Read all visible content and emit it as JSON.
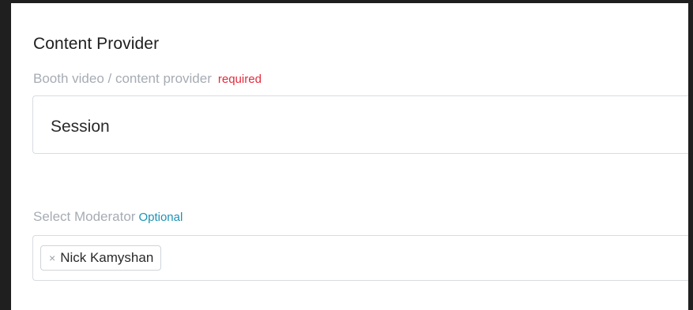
{
  "section": {
    "title": "Content Provider"
  },
  "content_provider": {
    "label": "Booth video / content provider",
    "required_tag": "required",
    "value": "Session"
  },
  "moderator": {
    "label": "Select Moderator",
    "optional_tag": "Optional",
    "selected": [
      {
        "name": "Nick Kamyshan",
        "remove_icon": "×"
      }
    ]
  },
  "colors": {
    "required": "#e5283a",
    "optional": "#1c92b7",
    "label": "#a6acb4",
    "border": "#d8dce0"
  }
}
